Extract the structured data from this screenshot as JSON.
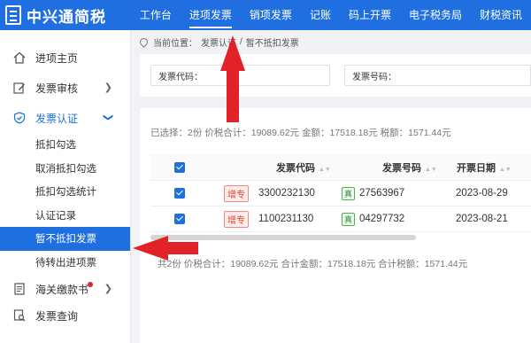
{
  "header": {
    "logo_text": "中兴通简税",
    "nav": [
      "工作台",
      "进项发票",
      "销项发票",
      "记账",
      "码上开票",
      "电子税务局",
      "财税资讯"
    ],
    "active_nav": "进项发票"
  },
  "sidebar": {
    "items": [
      {
        "label": "进项主页",
        "icon": "home-icon"
      },
      {
        "label": "发票审核",
        "icon": "edit-icon"
      },
      {
        "label": "发票认证",
        "icon": "shield-check-icon"
      },
      {
        "label": "海关缴款书",
        "icon": "document-icon"
      },
      {
        "label": "发票查询",
        "icon": "search-icon"
      }
    ],
    "subitems": [
      "抵扣勾选",
      "取消抵扣勾选",
      "抵扣勾选统计",
      "认证记录",
      "暂不抵扣发票",
      "待转出进项票"
    ],
    "active_sub": "暂不抵扣发票"
  },
  "breadcrumb": {
    "prefix": "当前位置：",
    "path": [
      "发票认证",
      "/",
      "暂不抵扣发票"
    ]
  },
  "filters": {
    "code_label": "发票代码：",
    "number_label": "发票号码："
  },
  "summary": {
    "top": "已选择：2份 价税合计：19089.62元 金额：17518.18元 税额：1571.44元",
    "bottom": "共2份 价税合计：19089.62元 合计金额：17518.18元 合计税额：1571.44元"
  },
  "table": {
    "headers": [
      "发票代码",
      "发票号码",
      "开票日期"
    ],
    "rows": [
      {
        "tag": "增专",
        "code": "3300232130",
        "num_tag": "真",
        "number": "27563967",
        "date": "2023-08-29"
      },
      {
        "tag": "增专",
        "code": "1100231130",
        "num_tag": "真",
        "number": "04297732",
        "date": "2023-08-21"
      }
    ]
  },
  "colors": {
    "primary": "#1f6fe0",
    "arrow": "#e32227"
  }
}
